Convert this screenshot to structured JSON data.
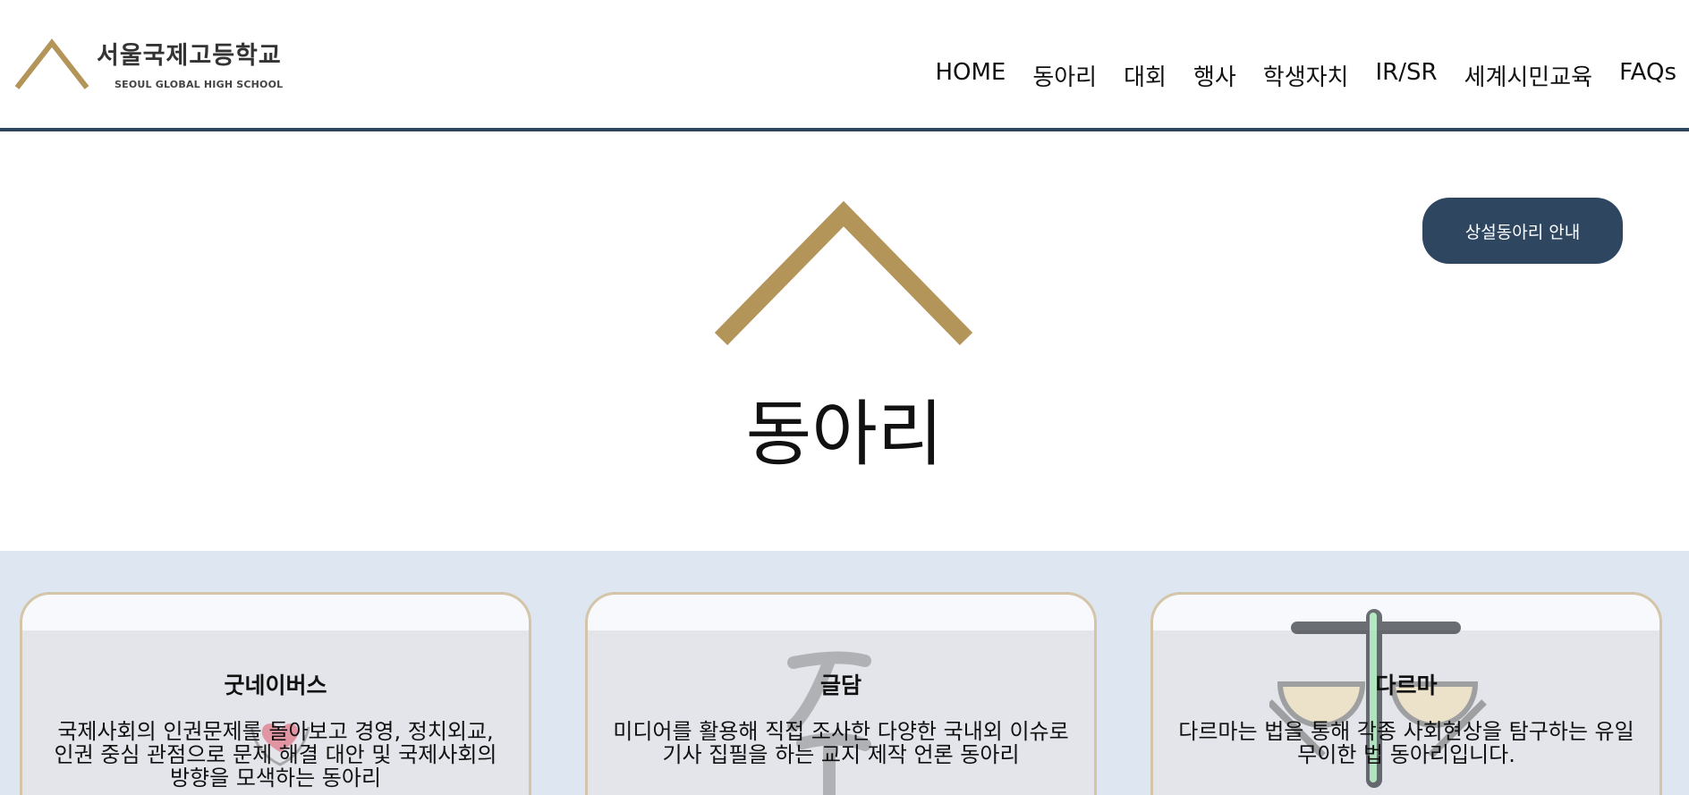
{
  "site": {
    "logo_ko": "서울국제고등학교",
    "logo_en": "SEOUL GLOBAL HIGH SCHOOL",
    "accent_color": "#b39459",
    "brand_navy": "#2f4661"
  },
  "nav": {
    "items": [
      "HOME",
      "동아리",
      "대회",
      "행사",
      "학생자치",
      "IR/SR",
      "세계시민교육",
      "FAQs"
    ]
  },
  "hero": {
    "title": "동아리",
    "guide_button": "상설동아리 안내"
  },
  "cards": [
    {
      "title": "굿네이버스",
      "description": "국제사회의 인권문제를 돌아보고 경영, 정치외교, 인권 중심 관점으로 문제 해결 대안 및 국제사회의 방향을 모색하는 동아리",
      "icon": "heart-hands-icon"
    },
    {
      "title": "글담",
      "description": "미디어를 활용해 직접 조사한 다양한 국내외 이슈로 기사 집필을 하는 교지 제작 언론 동아리",
      "icon": "calligraphy-icon"
    },
    {
      "title": "다르마",
      "description": "다르마는 법을 통해 각종 사회현상을 탐구하는 유일무이한 법 동아리입니다.",
      "icon": "scales-icon"
    }
  ]
}
